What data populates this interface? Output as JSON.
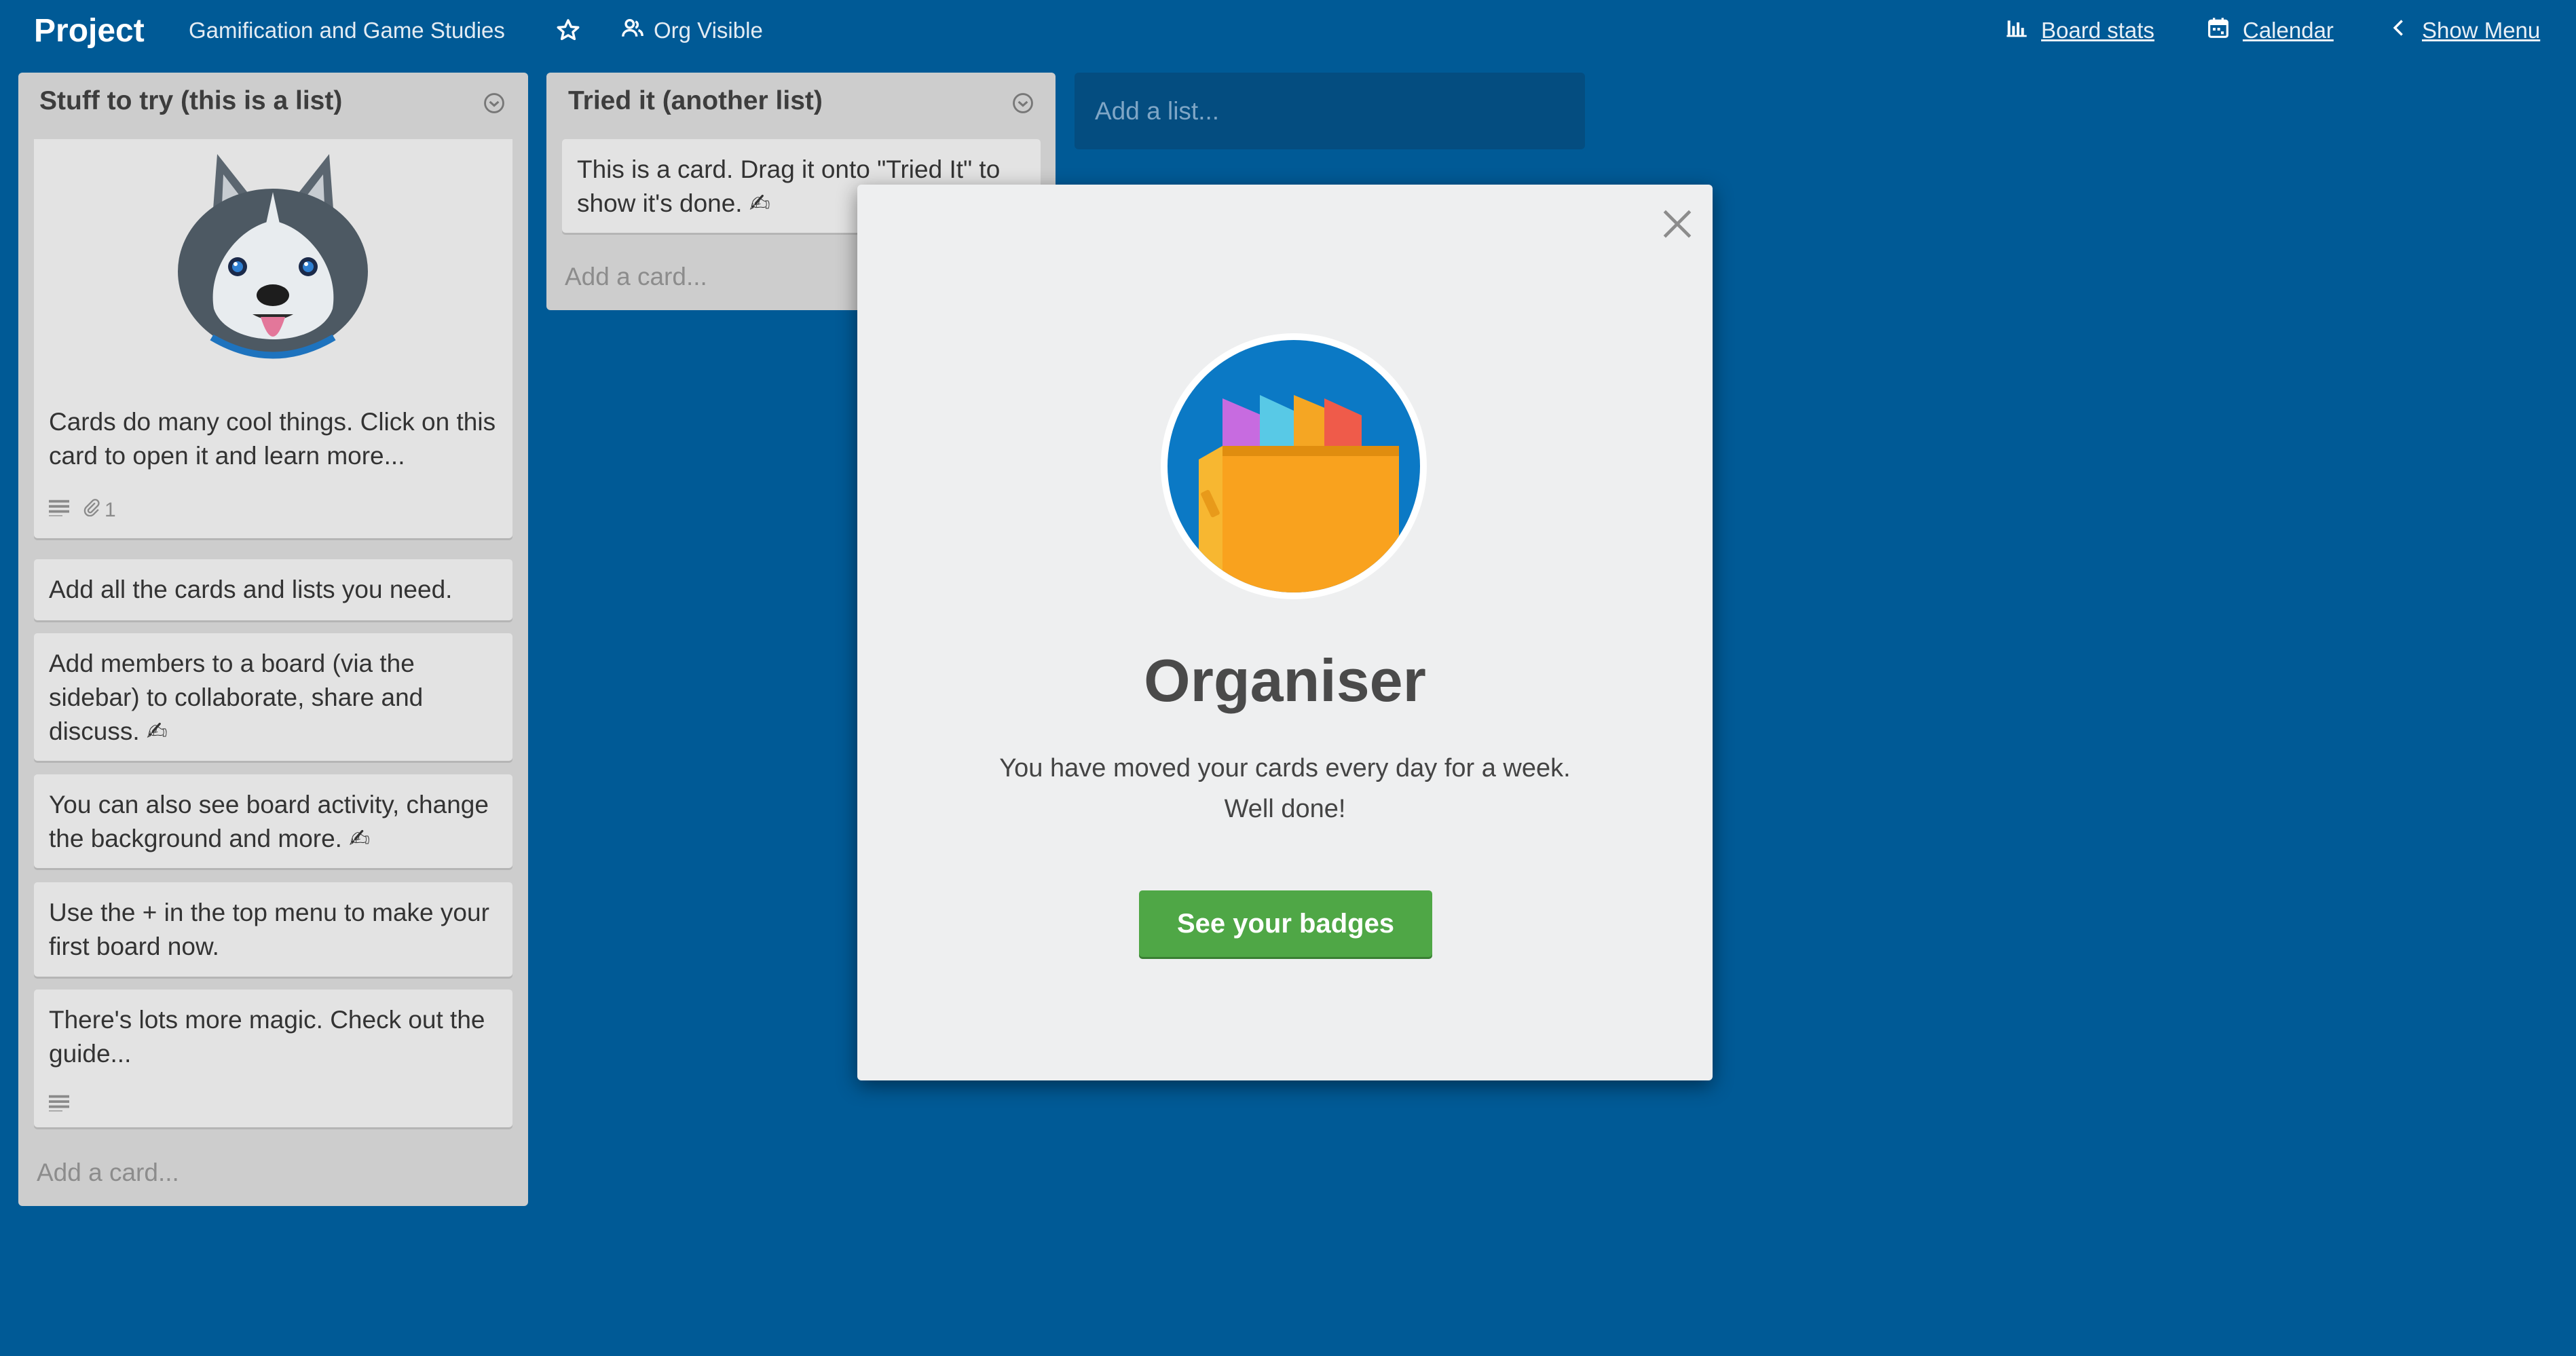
{
  "header": {
    "title": "Project",
    "org": "Gamification and Game Studies",
    "visibility": "Org Visible",
    "board_stats": "Board stats",
    "calendar": "Calendar",
    "show_menu": "Show Menu"
  },
  "lists": [
    {
      "title": "Stuff to try (this is a list)",
      "cards": [
        {
          "text": "Cards do many cool things. Click on this card to open it and learn more...",
          "attachment_count": "1"
        },
        {
          "text": "Add all the cards and lists you need."
        },
        {
          "text": "Add members to a board (via the sidebar) to collaborate, share and discuss. ✍"
        },
        {
          "text": "You can also see board activity, change the background and more. ✍"
        },
        {
          "text": "Use the + in the top menu to make your first board now."
        },
        {
          "text": "There's lots more magic. Check out the guide..."
        }
      ],
      "add_card": "Add a card..."
    },
    {
      "title": "Tried it (another list)",
      "cards": [
        {
          "text": "This is a card. Drag it onto \"Tried It\" to show it's done. ✍"
        }
      ],
      "add_card": "Add a card..."
    }
  ],
  "add_list_placeholder": "Add a list...",
  "modal": {
    "title": "Organiser",
    "line1": "You have moved your cards every day for a week.",
    "line2": "Well done!",
    "button": "See your badges"
  },
  "colors": {
    "board_bg": "#005a96",
    "list_bg": "#cdcdcd",
    "card_bg": "#e3e3e3",
    "button_green": "#4fa746",
    "badge_circle": "#0b79c5"
  }
}
